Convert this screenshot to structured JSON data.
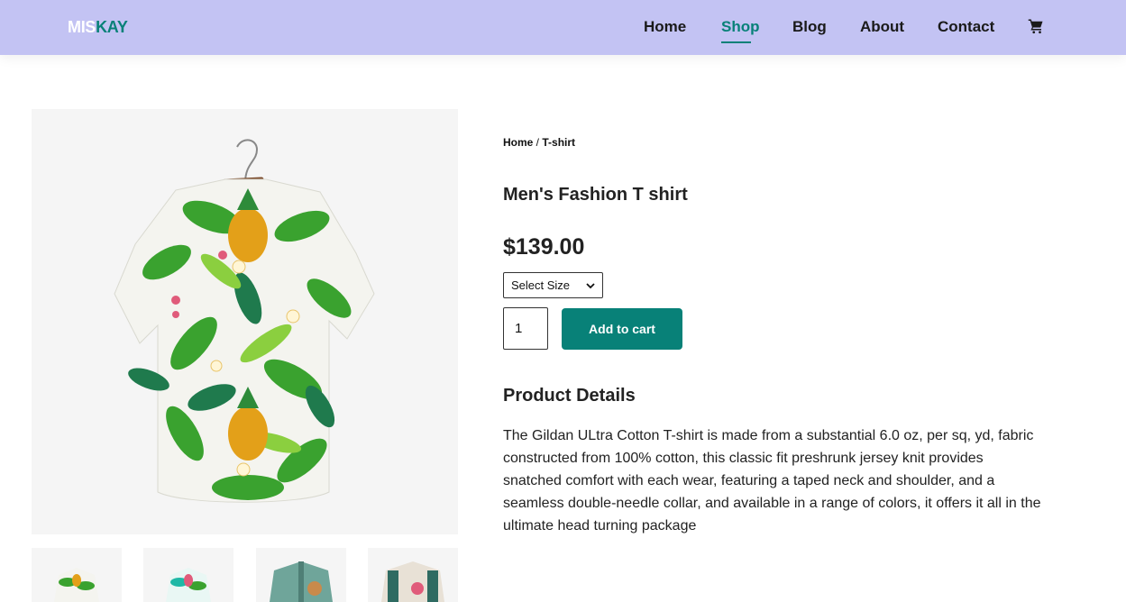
{
  "header": {
    "logo_part1": "MIS",
    "logo_part2": "KAY",
    "nav": [
      "Home",
      "Shop",
      "Blog",
      "About",
      "Contact"
    ],
    "active_nav": "Shop",
    "cart_icon": "cart-icon"
  },
  "product": {
    "breadcrumb_home": "Home",
    "breadcrumb_sep": " / ",
    "breadcrumb_current": "T-shirt",
    "title": "Men's Fashion T shirt",
    "price": "$139.00",
    "size_select_label": "Select Size",
    "quantity": "1",
    "add_to_cart_label": "Add to cart",
    "details_heading": "Product Details",
    "details_text": "The Gildan ULtra Cotton T-shirt is made from a substantial 6.0 oz, per sq, yd, fabric constructed from 100% cotton, this classic fit preshrunk jersey knit provides snatched comfort with each wear, featuring a taped neck and shoulder, and a seamless double-needle collar, and available in a range of colors, it offers it all in the ultimate head turning package"
  },
  "colors": {
    "header_bg": "#c3c3f3",
    "accent": "#088178"
  }
}
